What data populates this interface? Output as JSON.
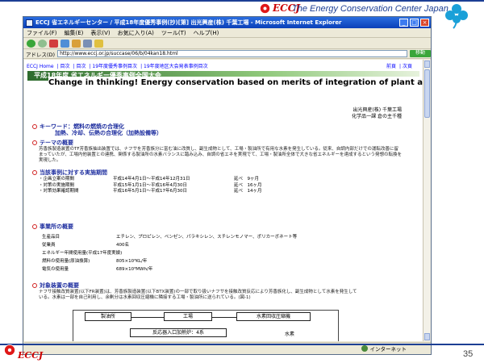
{
  "slide": {
    "ecc_top": "ECCJ",
    "org_name": "The Energy Conservation Center Japan",
    "ecc_bottom": "ECCJ",
    "page_number": "35",
    "headline": "Change in thinking! Energy conservation based on merits of integration of plant and refinery"
  },
  "window": {
    "title": "ECCJ 省エネルギーセンター / 平成18年度優秀事例(抄)[第] 出光興産(株) 千葉工場 - Microsoft Internet Explorer",
    "controls": {
      "minimize": "_",
      "maximize": "□",
      "close": "×"
    }
  },
  "menu": [
    "ファイル(F)",
    "編集(E)",
    "表示(V)",
    "お気に入り(A)",
    "ツール(T)",
    "ヘルプ(H)"
  ],
  "address": {
    "label": "アドレス(D)",
    "url": "http://www.eccj.or.jp/succase/06/b/04kan18.html",
    "go": "移動"
  },
  "nav": {
    "links": [
      "ECCJ Home",
      "目次",
      "目次",
      "19年度優秀事例目次",
      "19年度地区大会発表事例目次"
    ],
    "prev": "前頁",
    "next": "次頁"
  },
  "banner": "平成18年度 省エネルギー優秀事例全国大会",
  "author": {
    "company": "出光興産(株) 千葉工場",
    "dept": "化学品一課 倉の主千種"
  },
  "sections": {
    "keyword_head": "キーワード：燃料の燃焼の合理化",
    "keyword_sub": "加熱、冷却、伝熱の合理化（加熱設備等）",
    "theme_head": "テーマの概要",
    "theme_body": "芳香族製造装置のTF芳香族抽出装置では、ナフサを芳香族分に富む油に改質し、副生成物として、工場・製油所で有用な水素を発生している。従来、自調内部だけでの運転改善に留まっていたが、工場内他装置との連携、関係する製油所の水素バランスに踏み込み、自調の省エネを実現でて、工場・製油所全体で大きな省エネルギーを達成するという発想の転換を実現した。",
    "schedule_head": "当該事例に対する実施期間",
    "facility_head": "事業所の概要",
    "target_head": "対象装置の概要",
    "target_body": "ナフサ接触改質装置(以下FR装置)は、芳香族製造装置(以下BTX装置)の一部で取り扱いナフサを接触改質反応により芳香族化し、副生成物として水素を発生している。水素は一部を自己利用し、余剰分は水素回収圧縮機に隣接する工場・製油所に送られている。(図-1)"
  },
  "schedule": [
    {
      "item": "・企画立案の期間",
      "period": "平成14年4月1日～平成14年12月31日",
      "dur": "延べ　9ヶ月"
    },
    {
      "item": "・対策の実施期間",
      "period": "平成15年1月1日～平成16年4月30日",
      "dur": "延べ　16ヶ月"
    },
    {
      "item": "・対策効果確認期間",
      "period": "平成16年5月1日～平成17年6月30日",
      "dur": "延べ　14ヶ月"
    }
  ],
  "facility": [
    {
      "k": "生産品目",
      "v": "エチレン、プロピレン、ベンゼン、パラキシレン、スチレンモノマー、ポリカーボネート等"
    },
    {
      "k": "従業員",
      "v": "400名"
    },
    {
      "k": "エネルギー年間使用量(平成17年度実績)",
      "v": ""
    },
    {
      "k": "燃料の使用量(原油換算)",
      "v": "805×10³KL/年"
    },
    {
      "k": "電気の使用量",
      "v": "689×10³MWh/年"
    }
  ],
  "diagram": {
    "refinery": "製油所",
    "plant": "工場",
    "compressor": "水素回収圧縮機",
    "feed": "反応器入口加熱炉：4系",
    "hydrogen": "水素"
  },
  "status": {
    "zone": "インターネット"
  }
}
